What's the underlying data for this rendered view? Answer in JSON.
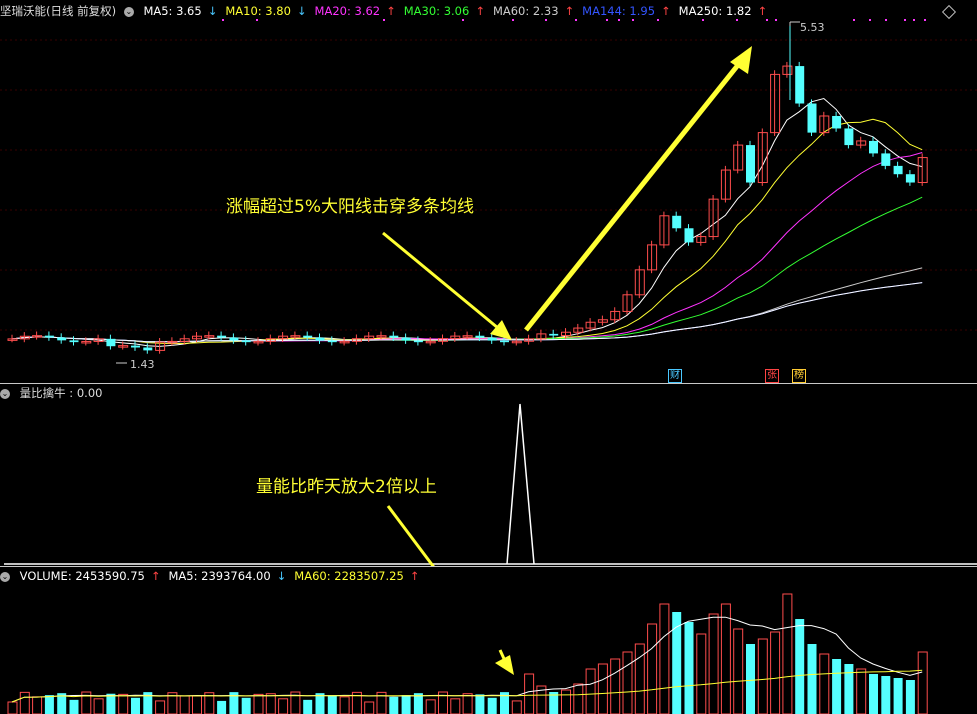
{
  "main": {
    "title": "坚瑞沃能(日线 前复权)",
    "ma": [
      {
        "label": "MA5: 3.65",
        "arrow": "↓",
        "color": "#ffffff",
        "arrow_color": "#4ac8ff"
      },
      {
        "label": "MA10: 3.80",
        "arrow": "↓",
        "color": "#ffff33",
        "arrow_color": "#4ac8ff"
      },
      {
        "label": "MA20: 3.62",
        "arrow": "↑",
        "color": "#ff33ff",
        "arrow_color": "#ff4444"
      },
      {
        "label": "MA30: 3.06",
        "arrow": "↑",
        "color": "#33ff33",
        "arrow_color": "#ff4444"
      },
      {
        "label": "MA60: 2.33",
        "arrow": "↑",
        "color": "#cccccc",
        "arrow_color": "#ff4444"
      },
      {
        "label": "MA144: 1.95",
        "arrow": "↑",
        "color": "#3355ff",
        "arrow_color": "#ff4444"
      },
      {
        "label": "MA250: 1.82",
        "arrow": "↑",
        "color": "#ffffff",
        "arrow_color": "#ff4444"
      }
    ],
    "high_label": "5.53",
    "low_label": "1.43",
    "annotation": "涨幅超过5%大阳线击穿多条均线",
    "badges": [
      {
        "text": "财",
        "color": "#4ac8ff"
      },
      {
        "text": "张",
        "color": "#ff4444"
      },
      {
        "text": "榜",
        "color": "#ffcc33"
      }
    ]
  },
  "indicator": {
    "title": "量比擒牛 : 0.00",
    "annotation": "量能比昨天放大2倍以上"
  },
  "volume": {
    "labels": [
      {
        "label": "VOLUME: 2453590.75",
        "arrow": "↑",
        "color": "#ffffff",
        "arrow_color": "#ff4444"
      },
      {
        "label": "MA5: 2393764.00",
        "arrow": "↓",
        "color": "#ffffff",
        "arrow_color": "#4ac8ff"
      },
      {
        "label": "MA60: 2283507.25",
        "arrow": "↑",
        "color": "#ffff33",
        "arrow_color": "#ff4444"
      }
    ]
  },
  "colors": {
    "up": "#ff4d4d",
    "down": "#55ffff",
    "annotation": "#ffff33"
  }
}
